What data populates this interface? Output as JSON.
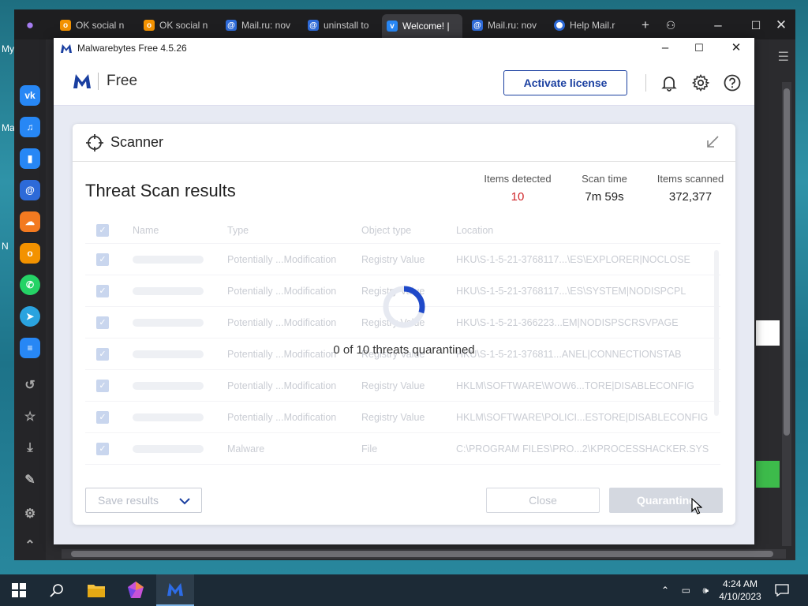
{
  "desktop": {
    "left_labels": [
      "My",
      "Ma",
      "N"
    ]
  },
  "browser": {
    "tabs": [
      {
        "label": "OK social n",
        "icon": "ok-icon"
      },
      {
        "label": "OK social n",
        "icon": "ok-icon"
      },
      {
        "label": "Mail.ru: nov",
        "icon": "mailru-icon"
      },
      {
        "label": "uninstall to",
        "icon": "mailru-icon"
      },
      {
        "label": "Welcome! |",
        "icon": "vk-icon",
        "active": true
      },
      {
        "label": "Mail.ru: nov",
        "icon": "mailru-icon"
      },
      {
        "label": "Help Mail.r",
        "icon": "help-icon"
      }
    ]
  },
  "malwarebytes": {
    "window_title": "Malwarebytes Free  4.5.26",
    "edition": "Free",
    "activate_label": "Activate license",
    "card_title": "Scanner",
    "results_title": "Threat Scan results",
    "stats": {
      "items_detected_label": "Items detected",
      "items_detected_value": "10",
      "scan_time_label": "Scan time",
      "scan_time_value": "7m 59s",
      "items_scanned_label": "Items scanned",
      "items_scanned_value": "372,377"
    },
    "columns": {
      "name": "Name",
      "type": "Type",
      "object_type": "Object type",
      "location": "Location"
    },
    "rows": [
      {
        "type": "Potentially ...Modification",
        "object_type": "Registry Value",
        "location": "HKU\\S-1-5-21-3768117...\\ES\\EXPLORER|NOCLOSE"
      },
      {
        "type": "Potentially ...Modification",
        "object_type": "Registry Value",
        "location": "HKU\\S-1-5-21-3768117...\\ES\\SYSTEM|NODISPCPL"
      },
      {
        "type": "Potentially ...Modification",
        "object_type": "Registry Value",
        "location": "HKU\\S-1-5-21-366223...EM|NODISPSCRSVPAGE"
      },
      {
        "type": "Potentially ...Modification",
        "object_type": "Registry Value",
        "location": "HKU\\S-1-5-21-376811...ANEL|CONNECTIONSTAB"
      },
      {
        "type": "Potentially ...Modification",
        "object_type": "Registry Value",
        "location": "HKLM\\SOFTWARE\\WOW6...TORE|DISABLECONFIG"
      },
      {
        "type": "Potentially ...Modification",
        "object_type": "Registry Value",
        "location": "HKLM\\SOFTWARE\\POLICI...ESTORE|DISABLECONFIG"
      },
      {
        "type": "Malware",
        "object_type": "File",
        "location": "C:\\PROGRAM FILES\\PRO...2\\KPROCESSHACKER.SYS"
      }
    ],
    "progress_text": "0 of 10 threats quarantined",
    "progress_fraction": 0.3,
    "save_label": "Save results",
    "close_label": "Close",
    "quarantine_label": "Quarantine",
    "colors": {
      "brand": "#1a3fa0",
      "detected": "#d0272a"
    }
  },
  "taskbar": {
    "time": "4:24 AM",
    "date": "4/10/2023"
  }
}
